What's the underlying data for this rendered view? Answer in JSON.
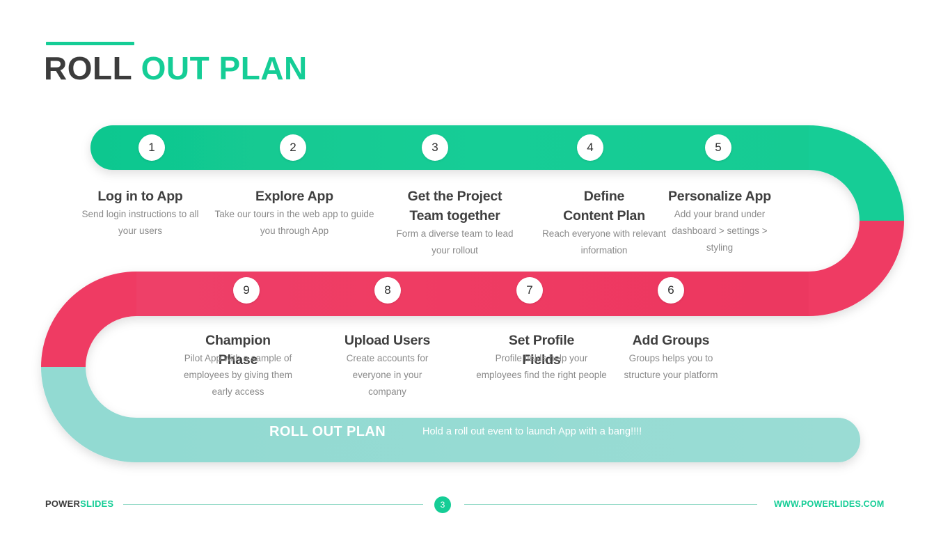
{
  "title": {
    "dark": "ROLL",
    "accent": " OUT PLAN"
  },
  "colors": {
    "green": "#15cd96",
    "green_dark": "#0fbf8b",
    "pink": "#ef3b63",
    "teal": "#92dad2",
    "text_dark": "#3f3f3f",
    "text_muted": "#8a8a8a",
    "white": "#ffffff"
  },
  "steps": [
    {
      "num": "1",
      "title": "Log in to App",
      "title2": "",
      "desc": "Send login instructions to all your users",
      "overlap": false
    },
    {
      "num": "2",
      "title": "Explore App",
      "title2": "",
      "desc": "Take our tours in the web app to guide you through App",
      "overlap": false
    },
    {
      "num": "3",
      "title": "Get the Project",
      "title2": "Team together",
      "desc": "Form a diverse team to lead your rollout",
      "overlap": false
    },
    {
      "num": "4",
      "title": "Define",
      "title2": "Content Plan",
      "desc": "Reach everyone with relevant information",
      "overlap": false
    },
    {
      "num": "5",
      "title": "Personalize App",
      "title2": "",
      "desc": "Add your brand under dashboard > settings > styling",
      "overlap": false
    },
    {
      "num": "6",
      "title": "Add Groups",
      "title2": "",
      "desc": "Groups helps you to structure your platform",
      "overlap": false
    },
    {
      "num": "7",
      "title": "Set Profile",
      "title2": "Fields",
      "desc": "Profile fields help your employees find the right people",
      "overlap": true
    },
    {
      "num": "8",
      "title": "Upload Users",
      "title2": "",
      "desc": "Create accounts for everyone in your company",
      "overlap": false
    },
    {
      "num": "9",
      "title": "Champion",
      "title2": "Phase",
      "desc": "Pilot App with a sample of employees by giving them early access",
      "overlap": true
    }
  ],
  "banner": {
    "title": "ROLL OUT PLAN",
    "desc": "Hold a roll out event to launch App with a bang!!!!"
  },
  "footer": {
    "brand_dark": "POWER",
    "brand_accent": "SLIDES",
    "page": "3",
    "url": "WWW.POWERLIDES.COM"
  }
}
